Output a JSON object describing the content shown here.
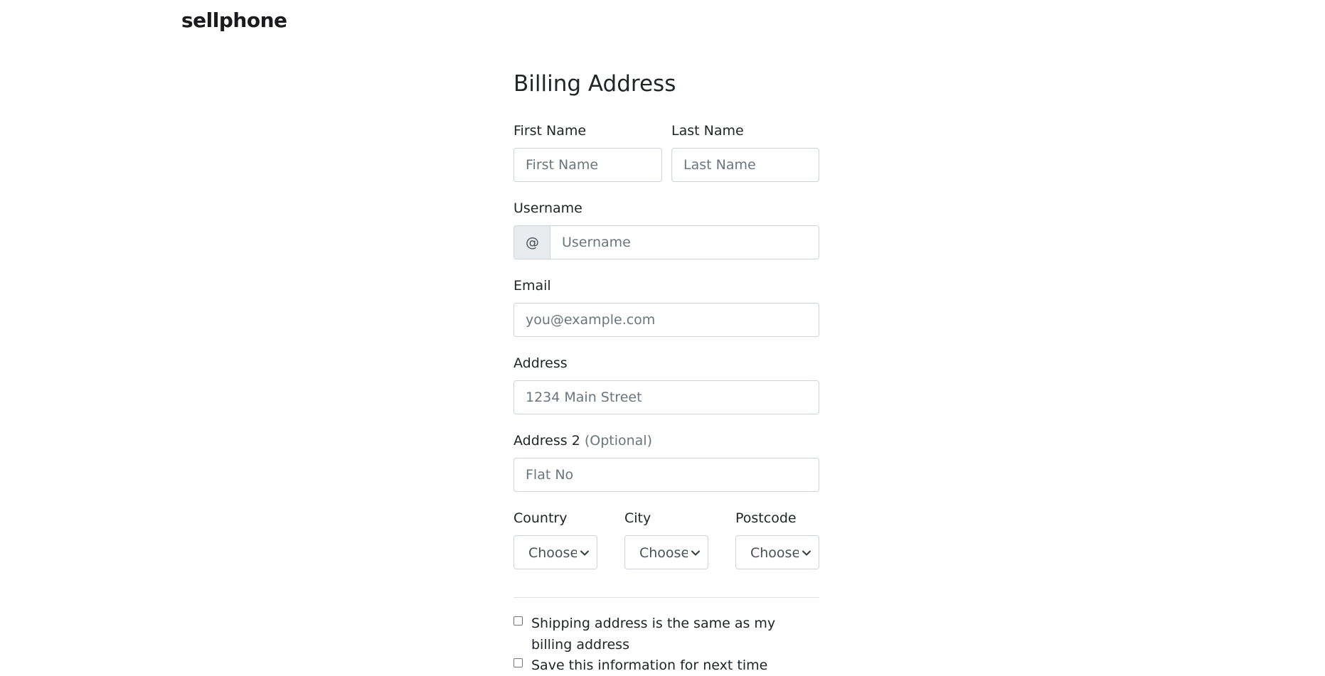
{
  "brand": {
    "logo_text": "sellphone"
  },
  "billing": {
    "title": "Billing Address",
    "first_name": {
      "label": "First Name",
      "placeholder": "First Name"
    },
    "last_name": {
      "label": "Last Name",
      "placeholder": "Last Name"
    },
    "username": {
      "label": "Username",
      "prefix": "@",
      "placeholder": "Username"
    },
    "email": {
      "label": "Email",
      "placeholder": "you@example.com"
    },
    "address": {
      "label": "Address",
      "placeholder": "1234 Main Street"
    },
    "address2": {
      "label": "Address 2",
      "optional": "(Optional)",
      "placeholder": "Flat No"
    },
    "country": {
      "label": "Country",
      "selected": "Choose..."
    },
    "city": {
      "label": "City",
      "selected": "Choose..."
    },
    "postcode": {
      "label": "Postcode",
      "selected": "Choose..."
    },
    "checkboxes": {
      "same_shipping": "Shipping address is the same as my billing address",
      "save_info": "Save this information for next time"
    }
  },
  "colors": {
    "border": "#ced4da",
    "addon_bg": "#e9ecef",
    "placeholder": "#6c757d",
    "text": "#212529"
  },
  "icons": {
    "select_arrow": "chevron-down-icon"
  }
}
